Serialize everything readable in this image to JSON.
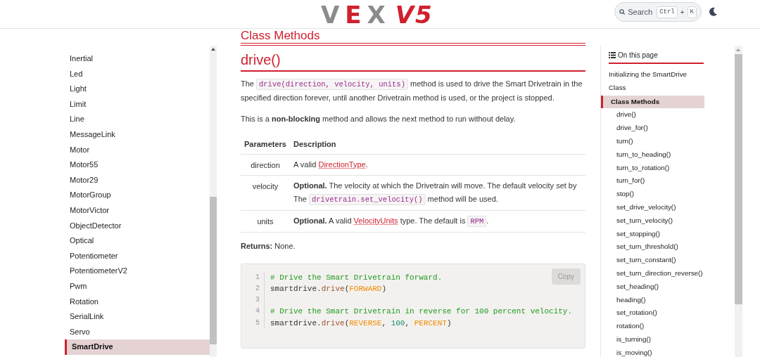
{
  "header": {
    "logo": {
      "brand_start": "V",
      "brand_accent": "E",
      "brand_end": "X",
      "product": "V5"
    },
    "search": {
      "label": "Search",
      "keys": [
        "Ctrl",
        "K"
      ],
      "joiner": "+"
    }
  },
  "sidebar": {
    "items": [
      {
        "label": "Inertial",
        "selected": false
      },
      {
        "label": "Led",
        "selected": false
      },
      {
        "label": "Light",
        "selected": false
      },
      {
        "label": "Limit",
        "selected": false
      },
      {
        "label": "Line",
        "selected": false
      },
      {
        "label": "MessageLink",
        "selected": false
      },
      {
        "label": "Motor",
        "selected": false
      },
      {
        "label": "Motor55",
        "selected": false
      },
      {
        "label": "Motor29",
        "selected": false
      },
      {
        "label": "MotorGroup",
        "selected": false
      },
      {
        "label": "MotorVictor",
        "selected": false
      },
      {
        "label": "ObjectDetector",
        "selected": false
      },
      {
        "label": "Optical",
        "selected": false
      },
      {
        "label": "Potentiometer",
        "selected": false
      },
      {
        "label": "PotentiometerV2",
        "selected": false
      },
      {
        "label": "Pwm",
        "selected": false
      },
      {
        "label": "Rotation",
        "selected": false
      },
      {
        "label": "SerialLink",
        "selected": false
      },
      {
        "label": "Servo",
        "selected": false
      },
      {
        "label": "SmartDrive",
        "selected": true
      }
    ]
  },
  "content": {
    "section_heading": "Class Methods",
    "heading": "drive()",
    "paragraphs": [
      [
        {
          "kind": "text",
          "text": "The "
        },
        {
          "kind": "code",
          "text": "drive(direction, velocity, units)"
        },
        {
          "kind": "text",
          "text": " method is used to drive the Smart Drivetrain in the specified direction forever, until another Drivetrain method is used, or the project is stopped."
        }
      ],
      [
        {
          "kind": "text",
          "text": "This is a **non-blocking** method and allows the next method to run without delay."
        }
      ]
    ],
    "table": {
      "columns": [
        "Parameters",
        "Description"
      ],
      "rows": [
        {
          "parameter": "direction",
          "description": [
            {
              "kind": "text",
              "text": "A valid "
            },
            {
              "kind": "link",
              "text": "DirectionType"
            },
            {
              "kind": "text",
              "text": "."
            }
          ]
        },
        {
          "parameter": "velocity",
          "description": [
            {
              "kind": "text",
              "text": "**Optional.** The velocity at which the Drivetrain will move. The default velocity set by The "
            },
            {
              "kind": "code",
              "text": "drivetrain.set_velocity()"
            },
            {
              "kind": "text",
              "text": " method will be used."
            }
          ]
        },
        {
          "parameter": "units",
          "description": [
            {
              "kind": "text",
              "text": "**Optional.** A valid "
            },
            {
              "kind": "link",
              "text": "VelocityUnits"
            },
            {
              "kind": "text",
              "text": " type. The default is "
            },
            {
              "kind": "code",
              "text": "RPM"
            },
            {
              "kind": "text",
              "text": "."
            }
          ]
        }
      ]
    },
    "returns": [
      {
        "kind": "text",
        "text": "**Returns:** None."
      }
    ],
    "code_block": {
      "copy_button": "Copy",
      "lines": [
        {
          "number": "1",
          "tokens": [
            {
              "kind": "comment",
              "text": "# Drive the Smart Drivetrain forward."
            }
          ]
        },
        {
          "number": "2",
          "tokens": [
            {
              "kind": "plain",
              "text": "smartdrive."
            },
            {
              "kind": "function",
              "text": "drive"
            },
            {
              "kind": "plain",
              "text": "("
            },
            {
              "kind": "constant",
              "text": "FORWARD"
            },
            {
              "kind": "plain",
              "text": ")"
            }
          ]
        },
        {
          "number": "3"
        },
        {
          "number": "4",
          "tokens": [
            {
              "kind": "comment",
              "text": "# Drive the Smart Drivetrain in reverse for 100 percent velocity."
            }
          ]
        },
        {
          "number": "5",
          "tokens": [
            {
              "kind": "plain",
              "text": "smartdrive."
            },
            {
              "kind": "function",
              "text": "drive"
            },
            {
              "kind": "plain",
              "text": "("
            },
            {
              "kind": "constant",
              "text": "REVERSE"
            },
            {
              "kind": "plain",
              "text": ", "
            },
            {
              "kind": "number",
              "text": "100"
            },
            {
              "kind": "plain",
              "text": ", "
            },
            {
              "kind": "constant",
              "text": "PERCENT"
            },
            {
              "kind": "plain",
              "text": ")"
            }
          ]
        }
      ]
    }
  },
  "toc": {
    "title": "On this page",
    "items": [
      {
        "label": "Initializing the SmartDrive Class",
        "selected": false
      },
      {
        "label": "Class Methods",
        "selected": true,
        "children": [
          {
            "label": "drive()",
            "selected": false
          },
          {
            "label": "drive_for()",
            "selected": false
          },
          {
            "label": "turn()",
            "selected": false
          },
          {
            "label": "turn_to_heading()",
            "selected": false
          },
          {
            "label": "turn_to_rotation()",
            "selected": false
          },
          {
            "label": "turn_for()",
            "selected": false
          },
          {
            "label": "stop()",
            "selected": false
          },
          {
            "label": "set_drive_velocity()",
            "selected": false
          },
          {
            "label": "set_turn_velocity()",
            "selected": false
          },
          {
            "label": "set_stopping()",
            "selected": false
          },
          {
            "label": "set_turn_threshold()",
            "selected": false
          },
          {
            "label": "set_turn_constant()",
            "selected": false
          },
          {
            "label": "set_turn_direction_reverse()",
            "selected": false
          },
          {
            "label": "set_heading()",
            "selected": false
          },
          {
            "label": "heading()",
            "selected": false
          },
          {
            "label": "set_rotation()",
            "selected": false
          },
          {
            "label": "rotation()",
            "selected": false
          },
          {
            "label": "is_turning()",
            "selected": false
          },
          {
            "label": "is_moving()",
            "selected": false
          }
        ]
      }
    ]
  }
}
